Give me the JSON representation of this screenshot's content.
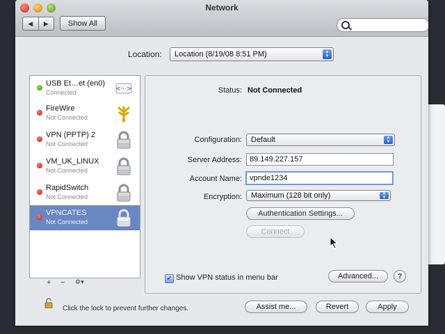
{
  "window": {
    "title": "Network"
  },
  "toolbar": {
    "back": "◀",
    "forward": "▶",
    "show_all": "Show All"
  },
  "location": {
    "label": "Location:",
    "value": "Location (8/19/08 8:51 PM)"
  },
  "services": [
    {
      "name": "USB Et…et (en0)",
      "status": "Connected",
      "color": "green",
      "icon": "ethernet-icon"
    },
    {
      "name": "FireWire",
      "status": "Not Connected",
      "color": "red",
      "icon": "firewire-icon"
    },
    {
      "name": "VPN (PPTP) 2",
      "status": "Not Connected",
      "color": "red",
      "icon": "lock-icon"
    },
    {
      "name": "VM_UK_LINUX",
      "status": "Not Connected",
      "color": "red",
      "icon": "lock-icon"
    },
    {
      "name": "RapidSwitch",
      "status": "Not Connected",
      "color": "red",
      "icon": "lock-icon"
    },
    {
      "name": "VPNCATES",
      "status": "Not Connected",
      "color": "red",
      "icon": "lock-icon",
      "selected": true
    }
  ],
  "sidebar_footer": {
    "add": "+",
    "remove": "−",
    "action": "⚙▾"
  },
  "detail": {
    "status_label": "Status:",
    "status_value": "Not Connected",
    "configuration_label": "Configuration:",
    "configuration_value": "Default",
    "server_label": "Server Address:",
    "server_value": "89.149.227.157",
    "account_label": "Account Name:",
    "account_value": "vpnde1234",
    "encryption_label": "Encryption:",
    "encryption_value": "Maximum (128 bit only)",
    "auth_button": "Authentication Settings...",
    "connect_button": "Connect"
  },
  "show_vpn_status": {
    "label": "Show VPN status in menu bar",
    "checked": true
  },
  "buttons": {
    "advanced": "Advanced...",
    "help": "?",
    "assist": "Assist me...",
    "revert": "Revert",
    "apply": "Apply"
  },
  "lock": {
    "text": "Click the lock to prevent further changes."
  },
  "colors": {
    "selection": "#6b87c2",
    "accent": "#2a62c4"
  }
}
